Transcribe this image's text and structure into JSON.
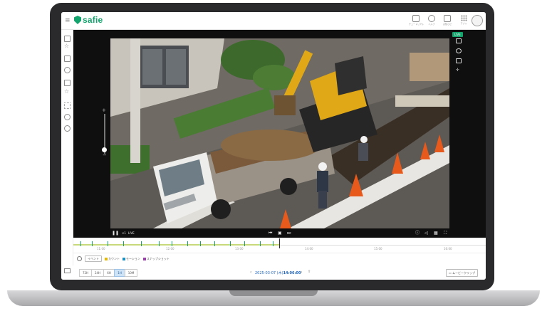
{
  "header": {
    "logo_text": "safie",
    "buttons": [
      {
        "label": "チュートリアル",
        "icon": "book-icon"
      },
      {
        "label": "ヘルプ",
        "icon": "help-icon"
      },
      {
        "label": "お知らせ",
        "icon": "bell-icon"
      },
      {
        "label": "アプリ",
        "icon": "grid-icon"
      }
    ]
  },
  "sidebar": {
    "icons": [
      "camera-icon",
      "star-icon",
      "film-icon",
      "cloud-icon",
      "layout-icon",
      "star-outline-icon",
      "apps-icon",
      "users-icon",
      "settings-icon"
    ]
  },
  "video": {
    "live_label": "LIVE",
    "playback": "LIVE",
    "speed": "×1"
  },
  "timeline": {
    "labels": [
      "11:00",
      "12:00",
      "13:00",
      "14:00",
      "15:00",
      "16:00"
    ]
  },
  "legend": {
    "event_button": "イベント",
    "items": [
      {
        "label": "カウント",
        "color": "#e6b800"
      },
      {
        "label": "モーション",
        "color": "#1f8fbf"
      },
      {
        "label": "スナップショット",
        "color": "#a03ab0"
      }
    ]
  },
  "footer": {
    "ranges": [
      "72H",
      "24H",
      "6H",
      "1H",
      "10M"
    ],
    "active_range": "1H",
    "date_text": "2025-03-07 (木)",
    "time_text": "14:06:00",
    "movie_clip_label": "ムービークリップ"
  },
  "colors": {
    "brand": "#13a36c",
    "accent": "#2266bb"
  }
}
